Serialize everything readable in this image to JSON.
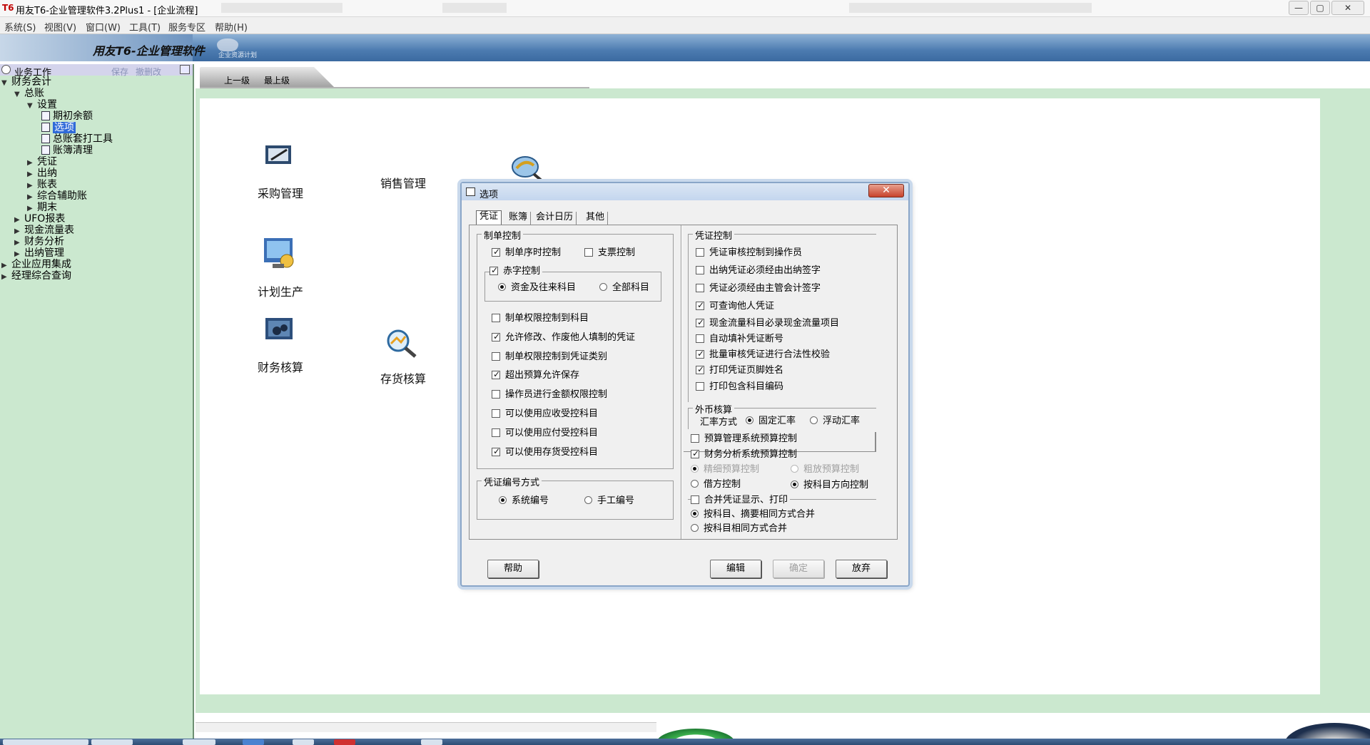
{
  "window": {
    "logo_text": "T6",
    "title": "用友T6-企业管理软件3.2Plus1 - [企业流程]",
    "sys_buttons": [
      "—",
      "▢",
      "✕"
    ]
  },
  "menu": [
    "系统(S)",
    "视图(V)",
    "窗口(W)",
    "工具(T)",
    "服务专区",
    "帮助(H)"
  ],
  "brand": {
    "logo": "用友T6-企业管理软件",
    "sub": "企业资源计划"
  },
  "nav": {
    "header_title": "业务工作",
    "save_label": "保存",
    "delete_label": "撤删改",
    "tree": [
      {
        "label": "财务会计",
        "toggle": "▼"
      },
      {
        "label": "总账",
        "toggle": "▼"
      },
      {
        "label": "设置",
        "toggle": "▼"
      },
      {
        "label": "期初余额"
      },
      {
        "label": "选项",
        "selected": true
      },
      {
        "label": "总账套打工具"
      },
      {
        "label": "账簿清理"
      },
      {
        "label": "凭证",
        "toggle": "▶"
      },
      {
        "label": "出纳",
        "toggle": "▶"
      },
      {
        "label": "账表",
        "toggle": "▶"
      },
      {
        "label": "综合辅助账",
        "toggle": "▶"
      },
      {
        "label": "期末",
        "toggle": "▶"
      },
      {
        "label": "UFO报表",
        "toggle": "▶"
      },
      {
        "label": "现金流量表",
        "toggle": "▶"
      },
      {
        "label": "财务分析",
        "toggle": "▶"
      },
      {
        "label": "出纳管理",
        "toggle": "▶"
      },
      {
        "label": "企业应用集成",
        "toggle": "▶"
      },
      {
        "label": "经理综合查询",
        "toggle": "▶"
      }
    ]
  },
  "breadcrumb": {
    "up": "上一级",
    "top": "最上级"
  },
  "modules": {
    "purchase": "采购管理",
    "sales": "销售管理",
    "planning": "计划生产",
    "finance": "财务核算",
    "inventory": "存货核算"
  },
  "dialog": {
    "title": "选项",
    "close": "✕",
    "tabs": [
      "凭证",
      "账簿",
      "会计日历",
      "其他"
    ],
    "voucher_control": {
      "title": "制单控制",
      "seq_control": "制单序时控制",
      "check_control": "支票控制",
      "red_control": "赤字控制",
      "red_funds": "资金及往来科目",
      "red_all": "全部科目",
      "items": [
        {
          "label": "制单权限控制到科目",
          "checked": false
        },
        {
          "label": "允许修改、作废他人填制的凭证",
          "checked": true
        },
        {
          "label": "制单权限控制到凭证类别",
          "checked": false
        },
        {
          "label": "超出预算允许保存",
          "checked": true
        },
        {
          "label": "操作员进行金额权限控制",
          "checked": false
        },
        {
          "label": "可以使用应收受控科目",
          "checked": false
        },
        {
          "label": "可以使用应付受控科目",
          "checked": false
        },
        {
          "label": "可以使用存货受控科目",
          "checked": true
        }
      ]
    },
    "numbering": {
      "title": "凭证编号方式",
      "system": "系统编号",
      "manual": "手工编号"
    },
    "voucher_ctrl": {
      "title": "凭证控制",
      "items": [
        {
          "label": "凭证审核控制到操作员",
          "checked": false
        },
        {
          "label": "出纳凭证必须经由出纳签字",
          "checked": false
        },
        {
          "label": "凭证必须经由主管会计签字",
          "checked": false
        },
        {
          "label": "可查询他人凭证",
          "checked": true
        },
        {
          "label": "现金流量科目必录现金流量项目",
          "checked": true
        },
        {
          "label": "自动填补凭证断号",
          "checked": false
        },
        {
          "label": "批量审核凭证进行合法性校验",
          "checked": true
        },
        {
          "label": "打印凭证页脚姓名",
          "checked": true
        },
        {
          "label": "打印包含科目编码",
          "checked": false
        }
      ]
    },
    "forex": {
      "title": "外币核算",
      "rate_label": "汇率方式",
      "fixed": "固定汇率",
      "floating": "浮动汇率"
    },
    "budget": {
      "budget_sys": "预算管理系统预算控制",
      "fin_analysis": "财务分析系统预算控制",
      "fine": "精细预算控制",
      "rough": "粗放预算控制",
      "debit": "借方控制",
      "by_direction": "按科目方向控制"
    },
    "merge": {
      "title": "合并凭证显示、打印",
      "opt1": "按科目、摘要相同方式合并",
      "opt2": "按科目相同方式合并"
    },
    "buttons": {
      "help": "帮助",
      "edit": "编辑",
      "ok": "确定",
      "cancel": "放弃"
    }
  }
}
